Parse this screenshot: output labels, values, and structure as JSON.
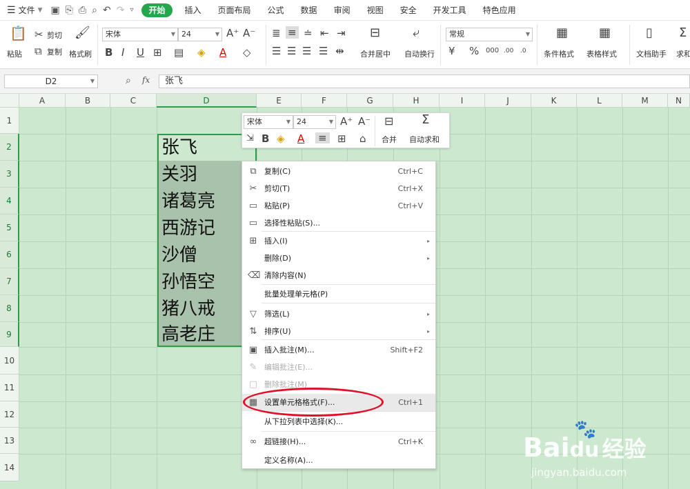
{
  "menubar": {
    "file_label": "文件",
    "tabs": [
      "开始",
      "插入",
      "页面布局",
      "公式",
      "数据",
      "审阅",
      "视图",
      "安全",
      "开发工具",
      "特色应用"
    ],
    "active_tab": "开始"
  },
  "ribbon": {
    "paste": "粘贴",
    "cut": "剪切",
    "copy": "复制",
    "format_painter": "格式刷",
    "font_name": "宋体",
    "font_size": "24",
    "merge_center": "合并居中",
    "wrap_text": "自动换行",
    "number_format": "常规",
    "cond_format": "条件格式",
    "table_style": "表格样式",
    "doc_assistant": "文档助手",
    "sum_partial": "求和"
  },
  "formula_bar": {
    "cell_ref": "D2",
    "fx": "fx",
    "value": "张飞"
  },
  "columns": [
    "A",
    "B",
    "C",
    "D",
    "E",
    "F",
    "G",
    "H",
    "I",
    "J",
    "K",
    "L",
    "M",
    "N"
  ],
  "rows": [
    "1",
    "2",
    "3",
    "4",
    "5",
    "6",
    "7",
    "8",
    "9",
    "10",
    "11",
    "12",
    "13",
    "14"
  ],
  "cells": [
    "张飞",
    "关羽",
    "诸葛亮",
    "西游记",
    "沙僧",
    "孙悟空",
    "猪八戒",
    "高老庄"
  ],
  "mini_toolbar": {
    "font_name": "宋体",
    "font_size": "24",
    "merge": "合并",
    "autosum": "自动求和"
  },
  "context_menu": [
    {
      "label": "复制(C)",
      "shortcut": "Ctrl+C",
      "icon": "copy-icon"
    },
    {
      "label": "剪切(T)",
      "shortcut": "Ctrl+X",
      "icon": "cut-icon"
    },
    {
      "label": "粘贴(P)",
      "shortcut": "Ctrl+V",
      "icon": "paste-icon"
    },
    {
      "label": "选择性粘贴(S)...",
      "shortcut": "",
      "icon": "paste-special-icon"
    },
    {
      "label": "插入(I)",
      "shortcut": "",
      "icon": "insert-icon",
      "submenu": true
    },
    {
      "label": "删除(D)",
      "shortcut": "",
      "icon": "",
      "submenu": true
    },
    {
      "label": "清除内容(N)",
      "shortcut": "",
      "icon": "eraser-icon"
    },
    {
      "label": "批量处理单元格(P)",
      "shortcut": "",
      "icon": ""
    },
    {
      "label": "筛选(L)",
      "shortcut": "",
      "icon": "filter-icon",
      "submenu": true
    },
    {
      "label": "排序(U)",
      "shortcut": "",
      "icon": "sort-icon",
      "submenu": true
    },
    {
      "label": "插入批注(M)...",
      "shortcut": "Shift+F2",
      "icon": "comment-icon"
    },
    {
      "label": "编辑批注(E)...",
      "shortcut": "",
      "icon": "edit-comment-icon",
      "disabled": true
    },
    {
      "label": "删除批注(M)",
      "shortcut": "",
      "icon": "delete-comment-icon",
      "disabled": true
    },
    {
      "label": "设置单元格格式(F)...",
      "shortcut": "Ctrl+1",
      "icon": "format-cells-icon",
      "highlighted": true
    },
    {
      "label": "从下拉列表中选择(K)...",
      "shortcut": "",
      "icon": ""
    },
    {
      "label": "超链接(H)...",
      "shortcut": "Ctrl+K",
      "icon": "link-icon"
    },
    {
      "label": "定义名称(A)...",
      "shortcut": "",
      "icon": ""
    }
  ],
  "watermark": {
    "brand": "Bai",
    "brand2": "du",
    "site": "经验",
    "url": "jingyan.baidu.com"
  },
  "colors": {
    "accent": "#22a84a",
    "grid_bg": "#cce8cf",
    "annotation": "#e0102a"
  }
}
